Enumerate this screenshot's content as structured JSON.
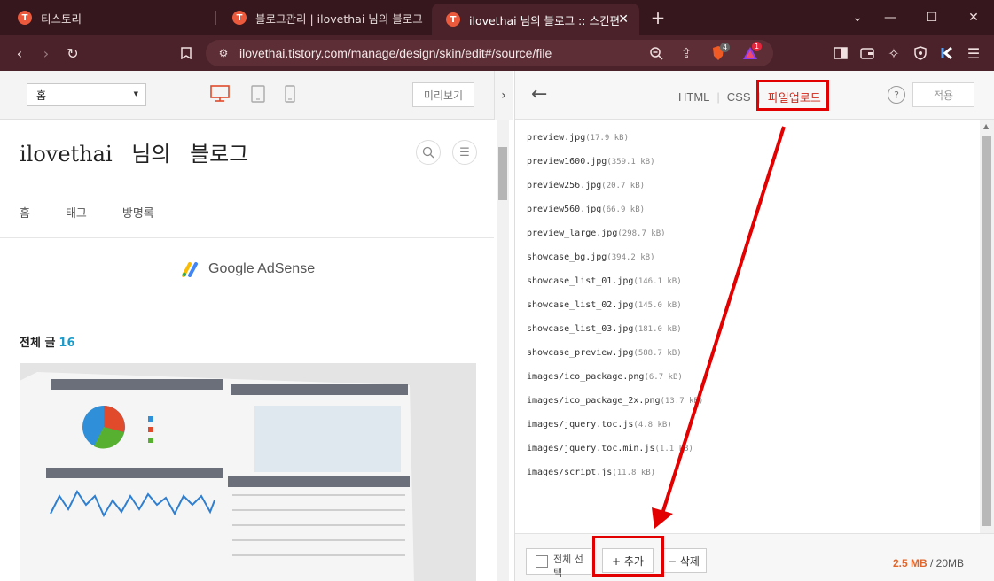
{
  "browser": {
    "tabs": [
      {
        "title": "티스토리",
        "favicon": "T"
      },
      {
        "title": "블로그관리 | ilovethai 님의 블로그",
        "favicon": "T"
      },
      {
        "title": "ilovethai 님의 블로그 :: 스킨편",
        "favicon": "T",
        "active": true
      }
    ],
    "new_tab": "+",
    "url": "ilovethai.tistory.com/manage/design/skin/edit#/source/file",
    "brave_badge": "4",
    "rewards_badge": "1"
  },
  "preview": {
    "page_select": "홈",
    "preview_button": "미리보기",
    "blog_title": "ilovethai 님의 블로그",
    "nav": [
      "홈",
      "태그",
      "방명록"
    ],
    "adsense": "Google AdSense",
    "all_posts_label": "전체 글",
    "all_posts_count": "16"
  },
  "editor": {
    "tabs": {
      "html": "HTML",
      "css": "CSS",
      "upload": "파일업로드"
    },
    "help": "?",
    "apply": "적용",
    "files": [
      {
        "name": "preview.jpg",
        "size": "(17.9 kB)"
      },
      {
        "name": "preview1600.jpg",
        "size": "(359.1 kB)"
      },
      {
        "name": "preview256.jpg",
        "size": "(20.7 kB)"
      },
      {
        "name": "preview560.jpg",
        "size": "(66.9 kB)"
      },
      {
        "name": "preview_large.jpg",
        "size": "(298.7 kB)"
      },
      {
        "name": "showcase_bg.jpg",
        "size": "(394.2 kB)"
      },
      {
        "name": "showcase_list_01.jpg",
        "size": "(146.1 kB)"
      },
      {
        "name": "showcase_list_02.jpg",
        "size": "(145.0 kB)"
      },
      {
        "name": "showcase_list_03.jpg",
        "size": "(181.0 kB)"
      },
      {
        "name": "showcase_preview.jpg",
        "size": "(588.7 kB)"
      },
      {
        "name": "images/ico_package.png",
        "size": "(6.7 kB)"
      },
      {
        "name": "images/ico_package_2x.png",
        "size": "(13.7 kB)"
      },
      {
        "name": "images/jquery.toc.js",
        "size": "(4.8 kB)"
      },
      {
        "name": "images/jquery.toc.min.js",
        "size": "(1.1 kB)"
      },
      {
        "name": "images/script.js",
        "size": "(11.8 kB)"
      }
    ],
    "select_all": "전체 선택",
    "add_button": "+ 추가",
    "delete_button": "− 삭제",
    "usage_used": "2.5 MB",
    "usage_total": " / 20MB"
  },
  "colors": {
    "highlight": "#e30000",
    "accent": "#d0291b",
    "usage": "#e0662c"
  }
}
